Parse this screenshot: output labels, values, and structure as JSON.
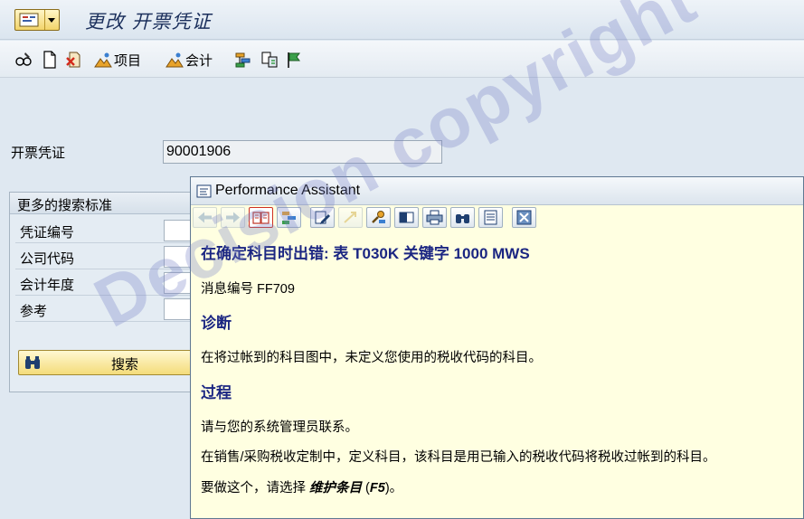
{
  "window": {
    "title": "更改 开票凭证"
  },
  "toolbar": {
    "items_label": "项目",
    "accounting_label": "会计"
  },
  "form": {
    "billing_doc_label": "开票凭证",
    "billing_doc_value": "90001906"
  },
  "search": {
    "group_title": "更多的搜索标准",
    "criteria": [
      {
        "label": "凭证编号"
      },
      {
        "label": "公司代码"
      },
      {
        "label": "会计年度"
      },
      {
        "label": "参考"
      }
    ],
    "button_label": "搜索"
  },
  "assistant": {
    "title": "Performance Assistant",
    "message_title": "在确定科目时出错: 表 T030K 关键字 1000 MWS",
    "message_no": "消息编号 FF709",
    "diagnosis_heading": "诊断",
    "diagnosis_text": "在将过帐到的科目图中，未定义您使用的税收代码的科目。",
    "procedure_heading": "过程",
    "procedure_text_1": "请与您的系统管理员联系。",
    "procedure_text_2": "在销售/采购税收定制中，定义科目，该科目是用已输入的税收代码将税收过帐到的科目。",
    "procedure_text_3_prefix": "要做这个，请选择 ",
    "procedure_text_3_action": "维护条目",
    "procedure_text_3_key_open": " (",
    "procedure_text_3_key": "F5",
    "procedure_text_3_key_close": ")。"
  },
  "watermark": {
    "text": "Decision copyright"
  }
}
